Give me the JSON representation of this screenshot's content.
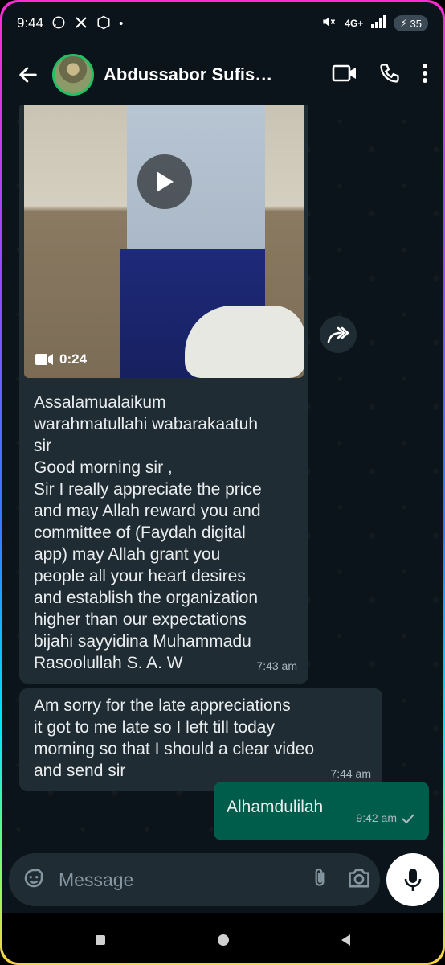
{
  "status_bar": {
    "time": "9:44",
    "network": "4G+",
    "battery": "35"
  },
  "header": {
    "contact_name": "Abdussabor Sufis…"
  },
  "messages": {
    "video": {
      "duration": "0:24"
    },
    "msg1": {
      "text": "Assalamualaikum\nwarahmatullahi wabarakaatuh\nsir\nGood morning sir ,\nSir I really appreciate the price\nand may Allah reward you and\ncommittee of (Faydah digital\napp) may Allah grant you\npeople all your heart desires\nand establish the organization\nhigher than our expectations\nbijahi sayyidina Muhammadu\nRasoolullah S. A. W",
      "time": "7:43 am"
    },
    "msg2": {
      "text": "Am sorry for the late appreciations\nit got to me late so I left till today\nmorning so that I should a clear video\nand send sir",
      "time": "7:44 am"
    },
    "msg3": {
      "text": "Alhamdulilah",
      "time": "9:42 am"
    }
  },
  "composer": {
    "placeholder": "Message"
  },
  "colors": {
    "incoming_bubble": "#202c33",
    "outgoing_bubble": "#005c4b",
    "chat_bg": "#0b141a",
    "accent": "#21c063"
  }
}
